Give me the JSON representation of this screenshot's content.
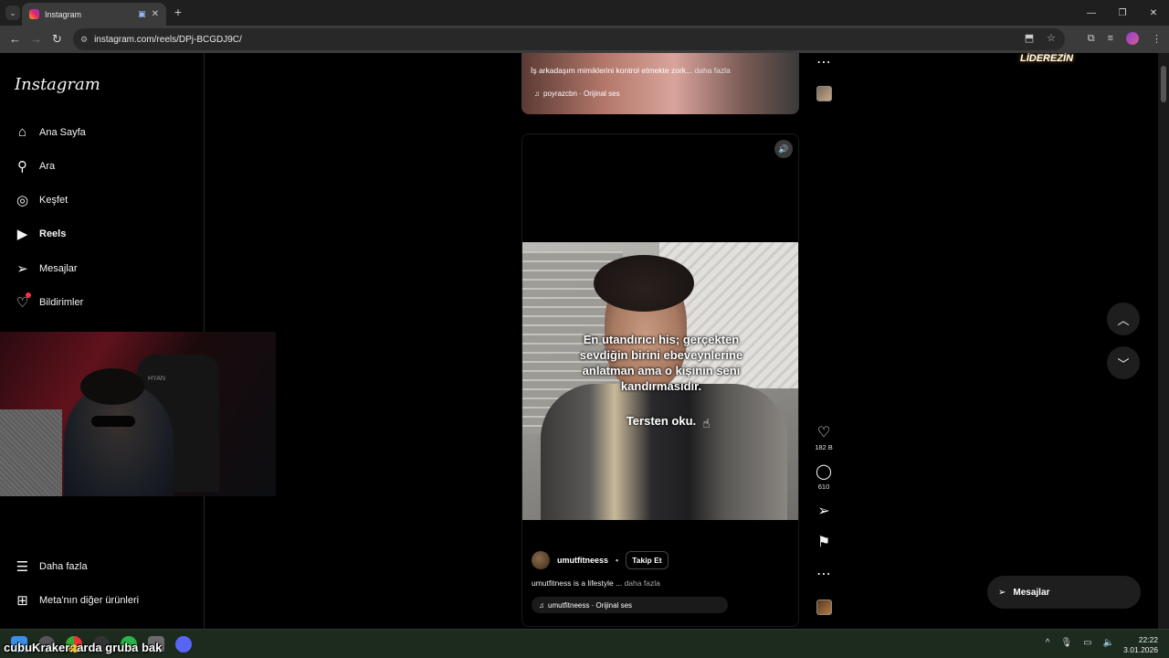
{
  "browser": {
    "tab_title": "Instagram",
    "url": "instagram.com/reels/DPj-BCGDJ9C/"
  },
  "sidebar": {
    "logo": "Instagram",
    "items": [
      {
        "label": "Ana Sayfa",
        "icon": "home-icon"
      },
      {
        "label": "Ara",
        "icon": "search-icon"
      },
      {
        "label": "Keşfet",
        "icon": "compass-icon"
      },
      {
        "label": "Reels",
        "icon": "reels-icon"
      },
      {
        "label": "Mesajlar",
        "icon": "send-icon"
      },
      {
        "label": "Bildirimler",
        "icon": "heart-icon"
      }
    ],
    "bottom_items": [
      {
        "label": "Daha fazla",
        "icon": "menu-icon"
      },
      {
        "label": "Meta'nın diğer ürünleri",
        "icon": "meta-products-icon"
      }
    ]
  },
  "webcam": {
    "chair_label": "HYAN"
  },
  "previous_reel": {
    "caption": "İş arkadaşım mimiklerini kontrol etmekte zork...",
    "more": "daha fazla",
    "audio": "poyrazcbn · Orijinal ses"
  },
  "reel": {
    "subtitle_lines": [
      "En utandırıcı his; gerçekten",
      "sevdiğin birini ebeveynlerine",
      "anlatman ama o kişinin seni",
      "kandırmasıdır."
    ],
    "subtitle2": "Tersten oku.",
    "username": "umutfitneess",
    "follow_label": "Takip Et",
    "description": "umutfitness is a lifestyle ...",
    "more": "daha fazla",
    "audio": "umutfitneess · Orijinal ses",
    "likes": "182 B",
    "comments": "610"
  },
  "watermark": "LİDEREZİN",
  "messages_button": "Mesajlar",
  "taskbar": {
    "overlay_text": "cubuKraker: arda gruba bak",
    "time": "22:22",
    "date": "3.01.2026"
  }
}
